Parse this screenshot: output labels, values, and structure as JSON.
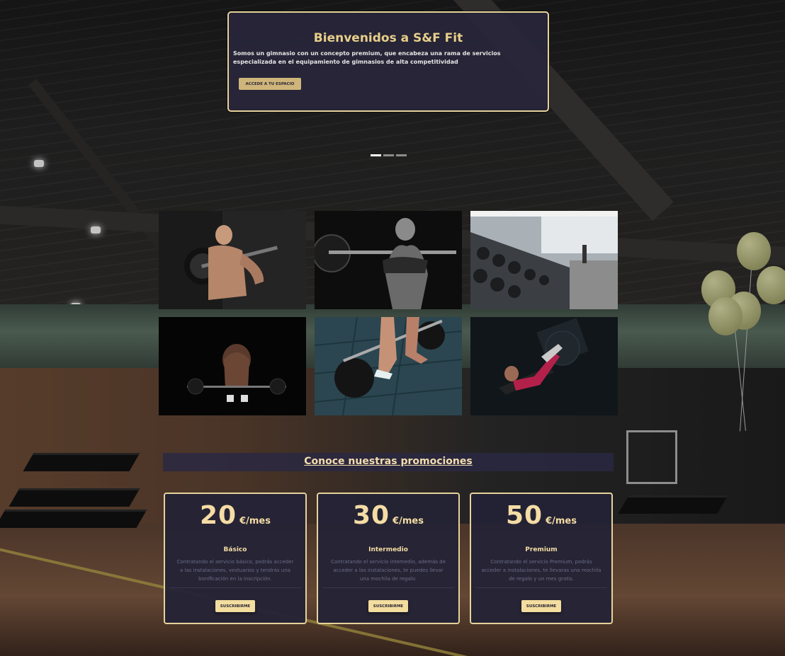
{
  "hero": {
    "title": "Bienvenidos a S&F Fit",
    "text": "Somos un gimnasio con un concepto premium, que encabeza una rama de servicios especializada en el equipamiento de gimnasios de alta competitividad",
    "button_label": "ACCEDE A TU ESPACIO",
    "indicators": 3,
    "active_indicator": 0
  },
  "gallery": {
    "photos": [
      {
        "icon": "weightlifter-curl-photo"
      },
      {
        "icon": "squat-barbell-photo"
      },
      {
        "icon": "dumbbell-rack-photo"
      },
      {
        "icon": "deadlift-dark-photo"
      },
      {
        "icon": "barbell-floor-photo"
      },
      {
        "icon": "leg-press-photo"
      }
    ]
  },
  "promotions": {
    "title": "Conoce nuestras promociones",
    "plans": [
      {
        "price": "20",
        "unit": "€/mes",
        "name": "Básico",
        "description": "Contratando el servicio básico, podrás acceder a las instalaciones, vestuarios y tendrás una bonificación en la inscripción.",
        "button_label": "SUSCRIBIRME"
      },
      {
        "price": "30",
        "unit": "€/mes",
        "name": "Intermedio",
        "description": "Contratando el servicio intemedio, además de acceder a las instalaciones, te puedes llevar una mochila de regalo.",
        "button_label": "SUSCRIBIRME"
      },
      {
        "price": "50",
        "unit": "€/mes",
        "name": "Premium",
        "description": "Contratando el servicio Premium, podrás acceder a instalaciones, te llevaras una mochila de regalo y un mes gratis.",
        "button_label": "SUSCRIBIRME"
      }
    ]
  },
  "colors": {
    "accent_gold": "#e6d39a",
    "card_background": "#242336",
    "button_gold": "#f3dd9f"
  }
}
